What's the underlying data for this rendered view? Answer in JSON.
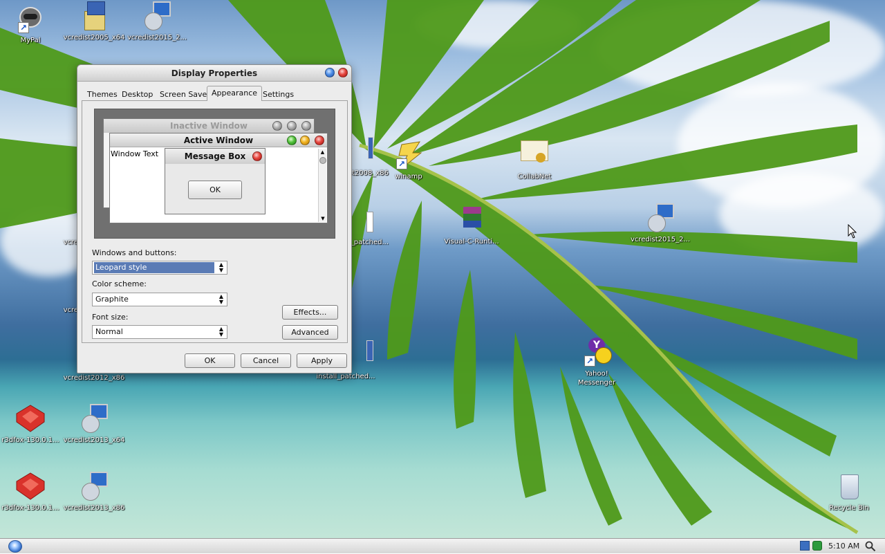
{
  "desktop_icons": [
    {
      "label": "MyPal"
    },
    {
      "label": "vcredist2005_x64"
    },
    {
      "label": "vcredist2015_2..."
    },
    {
      "label": "vcredist2008_x86"
    },
    {
      "label": "winamp"
    },
    {
      "label": "CollabNet"
    },
    {
      "label": "install_patched..."
    },
    {
      "label": "Visual-C-Runti..."
    },
    {
      "label": "vcredist2015_2..."
    },
    {
      "label": "vcredist2010_x64"
    },
    {
      "label": "vcredist2012_x64"
    },
    {
      "label": "vcredist2012_x86"
    },
    {
      "label": "install_patched..."
    },
    {
      "label": "Yahoo! Messenger"
    },
    {
      "label": "r3dfox-130.0.1..."
    },
    {
      "label": "vcredist2013_x64"
    },
    {
      "label": "r3dfox-130.0.1..."
    },
    {
      "label": "vcredist2013_x86"
    },
    {
      "label": "Recycle Bin"
    }
  ],
  "dialog": {
    "title": "Display Properties",
    "tabs": [
      {
        "label": "Themes"
      },
      {
        "label": "Desktop"
      },
      {
        "label": "Screen Saver"
      },
      {
        "label": "Appearance",
        "active": true
      },
      {
        "label": "Settings"
      }
    ],
    "preview": {
      "inactive_title": "Inactive Window",
      "active_title": "Active Window",
      "window_text": "Window Text",
      "message_box_title": "Message Box",
      "ok_label": "OK"
    },
    "windows_buttons_label": "Windows and buttons:",
    "windows_buttons_value": "Leopard style",
    "color_scheme_label": "Color scheme:",
    "color_scheme_value": "Graphite",
    "font_size_label": "Font size:",
    "font_size_value": "Normal",
    "effects_label": "Effects...",
    "advanced_label": "Advanced",
    "ok_label": "OK",
    "cancel_label": "Cancel",
    "apply_label": "Apply"
  },
  "taskbar": {
    "clock": "5:10 AM"
  },
  "colors": {
    "selection": "#5a7bb5",
    "dialog_bg": "#ececec"
  }
}
